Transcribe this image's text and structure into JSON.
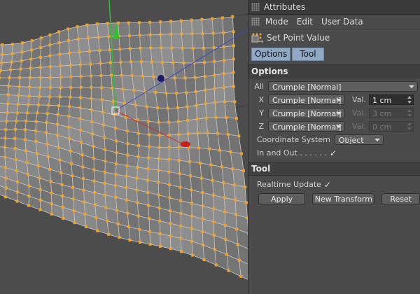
{
  "viewport": {
    "mesh_color": "#f4a324",
    "surface_color": "#8d8d8d",
    "axis_y_color": "#2fbf2f",
    "axis_x_color": "#d03030",
    "axis_z_color": "#3a48c8"
  },
  "panel": {
    "title": "Attributes",
    "menu": [
      "Mode",
      "Edit",
      "User Data"
    ],
    "tool_name": "Set Point Value",
    "tabs": [
      "Options",
      "Tool"
    ],
    "options_section": "Options",
    "all_label": "All",
    "all_value": "Crumple [Normal]",
    "rows": [
      {
        "axis": "X",
        "mode": "Crumple [Normal]",
        "val_label": "Val.",
        "value": "1 cm",
        "enabled": true
      },
      {
        "axis": "Y",
        "mode": "Crumple [Normal]",
        "val_label": "Val.",
        "value": "3 cm",
        "enabled": false
      },
      {
        "axis": "Z",
        "mode": "Crumple [Normal]",
        "val_label": "Val.",
        "value": "0 cm",
        "enabled": false
      }
    ],
    "coord_label": "Coordinate System",
    "coord_value": "Object",
    "inout_label": "In and Out . . . . . .",
    "inout_checked": "✓",
    "tool_section": "Tool",
    "realtime_label": "Realtime Update",
    "realtime_checked": "✓",
    "buttons": {
      "apply": "Apply",
      "new_transform": "New Transform",
      "reset": "Reset"
    }
  }
}
